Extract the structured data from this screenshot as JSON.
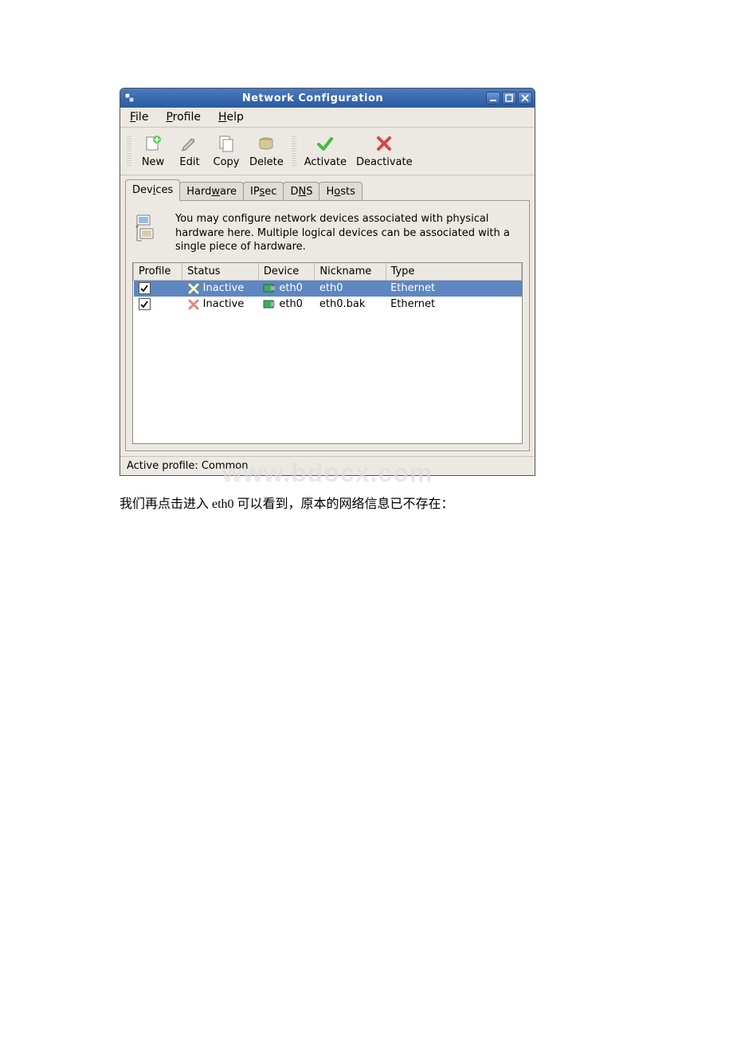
{
  "window": {
    "title": "Network Configuration"
  },
  "menu": {
    "file": "File",
    "profile": "Profile",
    "help": "Help"
  },
  "toolbar": {
    "new": "New",
    "edit": "Edit",
    "copy": "Copy",
    "delete": "Delete",
    "activate": "Activate",
    "deactivate": "Deactivate"
  },
  "tabs": {
    "devices": "Devices",
    "hardware": "Hardware",
    "ipsec": "IPsec",
    "dns": "DNS",
    "hosts": "Hosts"
  },
  "info_text": "You may configure network devices associated with physical hardware here.  Multiple logical devices can be associated with a single piece of hardware.",
  "columns": {
    "profile": "Profile",
    "status": "Status",
    "device": "Device",
    "nickname": "Nickname",
    "type": "Type"
  },
  "rows": [
    {
      "checked": true,
      "status": "Inactive",
      "device": "eth0",
      "nickname": "eth0",
      "type": "Ethernet",
      "selected": true
    },
    {
      "checked": true,
      "status": "Inactive",
      "device": "eth0",
      "nickname": "eth0.bak",
      "type": "Ethernet",
      "selected": false
    }
  ],
  "statusbar": "Active profile: Common",
  "watermark": "www.bdocx.com",
  "caption": "我们再点击进入 eth0 可以看到，原本的网络信息已不存在："
}
